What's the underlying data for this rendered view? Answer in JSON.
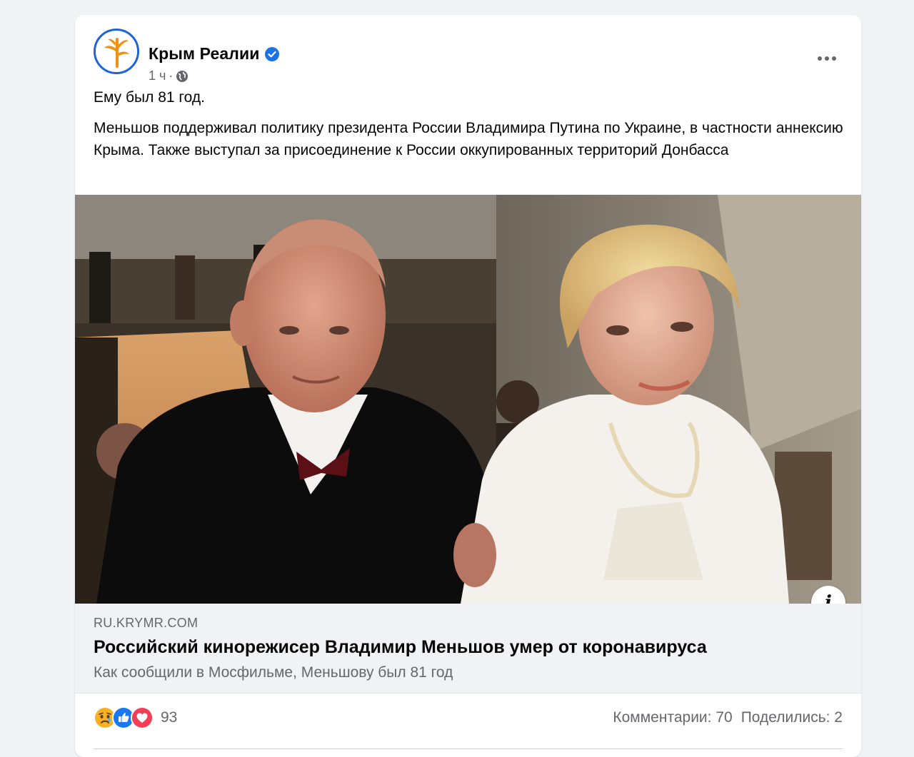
{
  "post": {
    "page_name": "Крым Реалии",
    "time": "1 ч",
    "meta_separator": "·",
    "privacy_icon": "globe-icon",
    "verified_icon": "verified-badge-icon",
    "more_icon": "more-options-icon",
    "text_line1": "Ему был 81 год.",
    "text_line2": "Меньшов поддерживал политику президента России Владимира Путина по Украине, в частности аннексию Крыма. Также выступал за присоединение к России оккупированных территорий Донбасса"
  },
  "link_preview": {
    "domain": "RU.KRYMR.COM",
    "title": "Российский кинорежисер Владимир Меньшов умер от коронавируса",
    "description": "Как сообщили в Мосфильме, Меньшову был 81 год",
    "info_label": "i"
  },
  "reactions": {
    "icons": [
      "sad-reaction-icon",
      "like-reaction-icon",
      "love-reaction-icon"
    ],
    "count": "93",
    "comments": "Комментарии: 70",
    "shares": "Поделились: 2"
  },
  "colors": {
    "brand_blue": "#1b74e4",
    "logo_orange": "#f29111",
    "like_blue": "#1877f2",
    "love_red": "#f33e58",
    "sad_yellow": "#f7b125"
  }
}
